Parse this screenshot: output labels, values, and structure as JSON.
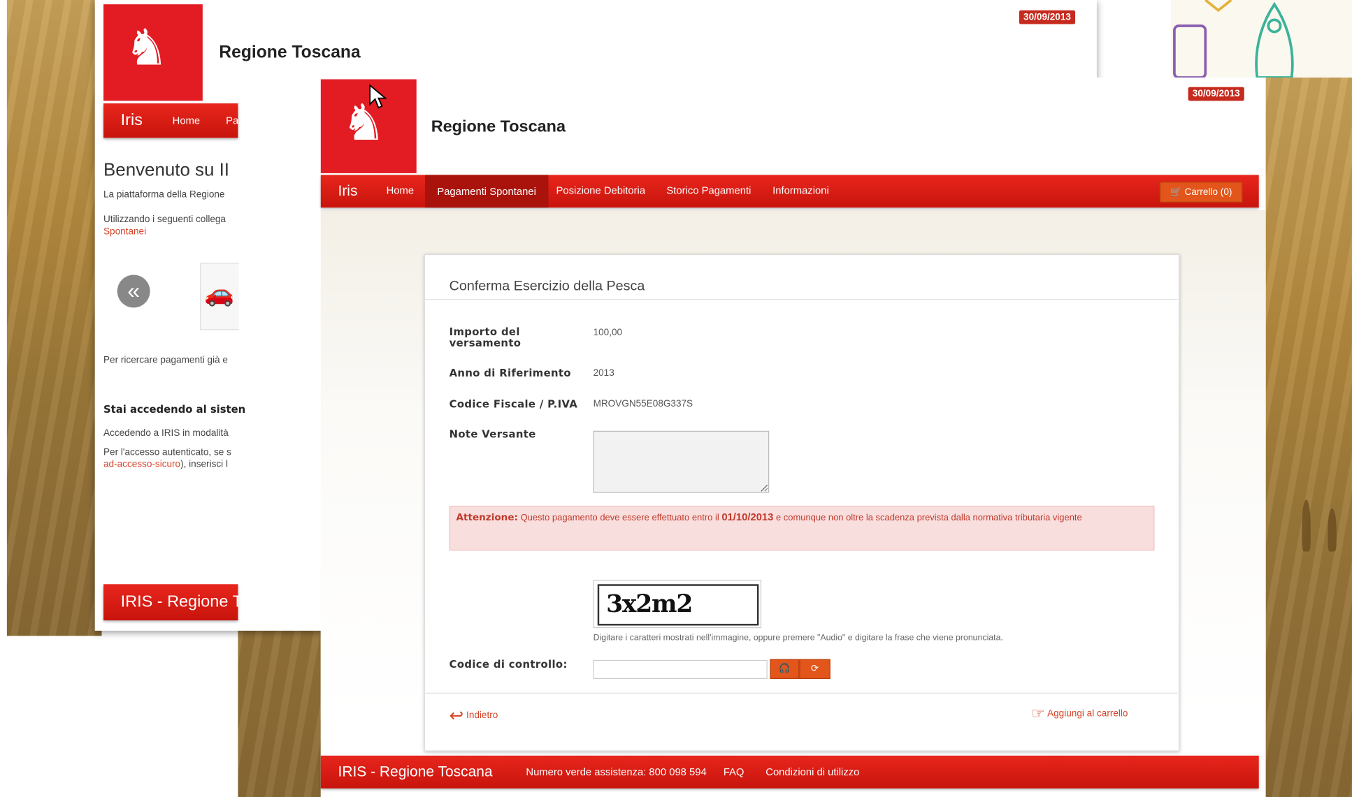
{
  "back_window": {
    "date_badge": "30/09/2013",
    "brand": "Regione Toscana",
    "nav": {
      "app": "Iris",
      "home": "Home",
      "partial": "Pa"
    },
    "welcome_title": "Benvenuto su II",
    "intro_1": "La piattaforma della Regione",
    "intro_2": "Utilizzando i seguenti collega",
    "intro_link": "Spontanei",
    "search_text": "Per ricercare pagamenti già e",
    "access_title": "Stai accedendo al sisten",
    "access_1": "Accedendo a IRIS in modalità",
    "access_2": "Per l'accesso autenticato, se s",
    "access_link": "ad-accesso-sicuro",
    "access_3": "), inserisci l",
    "footer": "IRIS - Regione T"
  },
  "header": {
    "brand": "Regione Toscana",
    "date_badge": "30/09/2013"
  },
  "nav": {
    "app": "Iris",
    "items": [
      "Home",
      "Pagamenti Spontanei",
      "Posizione Debitoria",
      "Storico Pagamenti",
      "Informazioni"
    ],
    "cart": "Carrello (0)"
  },
  "form": {
    "title": "Conferma Esercizio della Pesca",
    "importo_label_1": "Importo del",
    "importo_label_2": "versamento",
    "importo_value": "100,00",
    "anno_label": "Anno di Riferimento",
    "anno_value": "2013",
    "cf_label": "Codice Fiscale / P.IVA",
    "cf_value": "MROVGN55E08G337S",
    "note_label": "Note Versante",
    "alert_strong": "Attenzione:",
    "alert_text": " Questo pagamento deve essere effettuato entro il ",
    "alert_date": "01/10/2013",
    "alert_text2": " e comunque non oltre la scadenza prevista dalla normativa tributaria vigente",
    "captcha_text": "3x2m2",
    "captcha_hint": "Digitare i caratteri mostrati nell'immagine, oppure premere \"Audio\" e digitare la frase che viene pronunciata.",
    "code_label": "Codice di controllo:",
    "back": "Indietro",
    "add_cart": "Aggiungi al carrello"
  },
  "footer": {
    "title": "IRIS - Regione Toscana",
    "phone": "Numero verde assistenza: 800 098 594",
    "faq": "FAQ",
    "conditions": "Condizioni di utilizzo"
  },
  "colors": {
    "brand_red": "#e31b23",
    "accent_orange": "#e2561b",
    "alert_bg": "#f9dede"
  }
}
